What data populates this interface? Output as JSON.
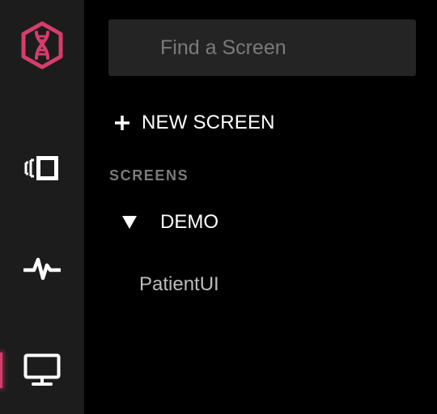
{
  "sidebar": {
    "logo_icon": "dna-hexagon-icon",
    "items": [
      {
        "name": "panels",
        "icon": "panels-icon"
      },
      {
        "name": "activity",
        "icon": "heartbeat-icon"
      },
      {
        "name": "screens",
        "icon": "monitor-icon",
        "active": true
      }
    ],
    "accent_color": "#d63d6b"
  },
  "search": {
    "placeholder": "Find a Screen",
    "value": ""
  },
  "actions": {
    "new_screen_label": "NEW SCREEN",
    "new_screen_icon": "plus-icon"
  },
  "screens": {
    "section_label": "SCREENS",
    "groups": [
      {
        "label": "DEMO",
        "expanded": true,
        "items": [
          {
            "label": "PatientUI"
          }
        ]
      }
    ]
  }
}
